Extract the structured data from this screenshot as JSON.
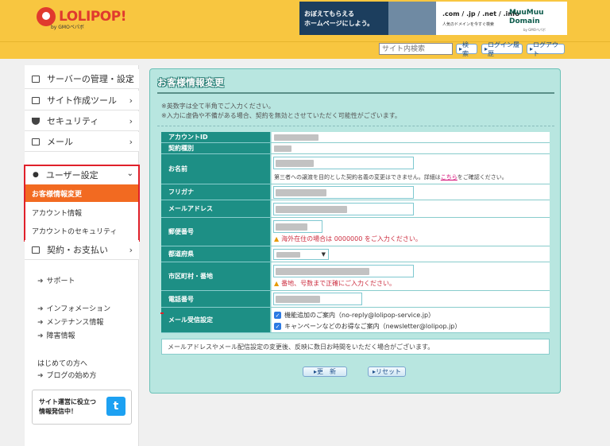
{
  "header": {
    "logo_text": "LOLIPOP!",
    "logo_sub": "by GMOペパボ",
    "banner1_line1": "おぼえてもらえる",
    "banner1_line2": "ホームページにしよう。",
    "banner2_domains": ".com / .jp / .net / .info",
    "banner2_sub": "人気のドメインを今すぐ検索",
    "banner2_logo1": "MuuMuu",
    "banner2_logo2": "Domain",
    "banner2_gmo": "by GMOペパボ"
  },
  "toolbar": {
    "search_placeholder": "サイト内検索",
    "search_button": "検索",
    "login_history": "ログイン履歴",
    "logout": "ログアウト"
  },
  "sidebar": {
    "items": [
      {
        "label": "サーバーの管理・設定",
        "icon": "server-icon"
      },
      {
        "label": "サイト作成ツール",
        "icon": "laptop-icon"
      },
      {
        "label": "セキュリティ",
        "icon": "shield-icon"
      },
      {
        "label": "メール",
        "icon": "mail-icon"
      }
    ],
    "user_settings": {
      "label": "ユーザー設定",
      "sub": [
        "お客様情報変更",
        "アカウント情報",
        "アカウントのセキュリティ"
      ]
    },
    "billing": "契約・お支払い",
    "links": [
      "サポート",
      "インフォメーション",
      "メンテナンス情報",
      "障害情報"
    ],
    "beginner": "はじめての方へ",
    "blog": "ブログの始め方",
    "twitter_line1": "サイト運営に役立つ",
    "twitter_line2": "情報発信中！",
    "twitter_glyph": "t"
  },
  "main": {
    "title": "お客様情報変更",
    "notes": [
      "※英数字は全て半角でご入力ください。",
      "※入力に虚偽や不備がある場合、契約を無効とさせていただく可能性がございます。"
    ],
    "fields": {
      "account_id": "アカウントID",
      "contract_type": "契約種別",
      "name": "お名前",
      "name_hint_pre": "第三者への譲渡を目的とした契約名義の変更はできません。詳細は",
      "name_hint_link": "こちら",
      "name_hint_post": "をご確認ください。",
      "furigana": "フリガナ",
      "email": "メールアドレス",
      "postal": "郵便番号",
      "postal_warn": "海外在住の場合は 0000000 をご入力ください。",
      "prefecture": "都道府県",
      "city": "市区町村・番地",
      "city_warn": "番地、号数まで正確にご入力ください。",
      "phone": "電話番号",
      "mail_settings": "メール受信設定",
      "mail_opt1": "機能追加のご案内（no-reply@lolipop-service.jp）",
      "mail_opt2": "キャンペーンなどのお得なご案内（newsletter@lolipop.jp）"
    },
    "info_note": "メールアドレスやメール配信設定の変更後、反映に数日お時間をいただく場合がございます。",
    "update_button": "更　新",
    "reset_button": "リセット"
  }
}
